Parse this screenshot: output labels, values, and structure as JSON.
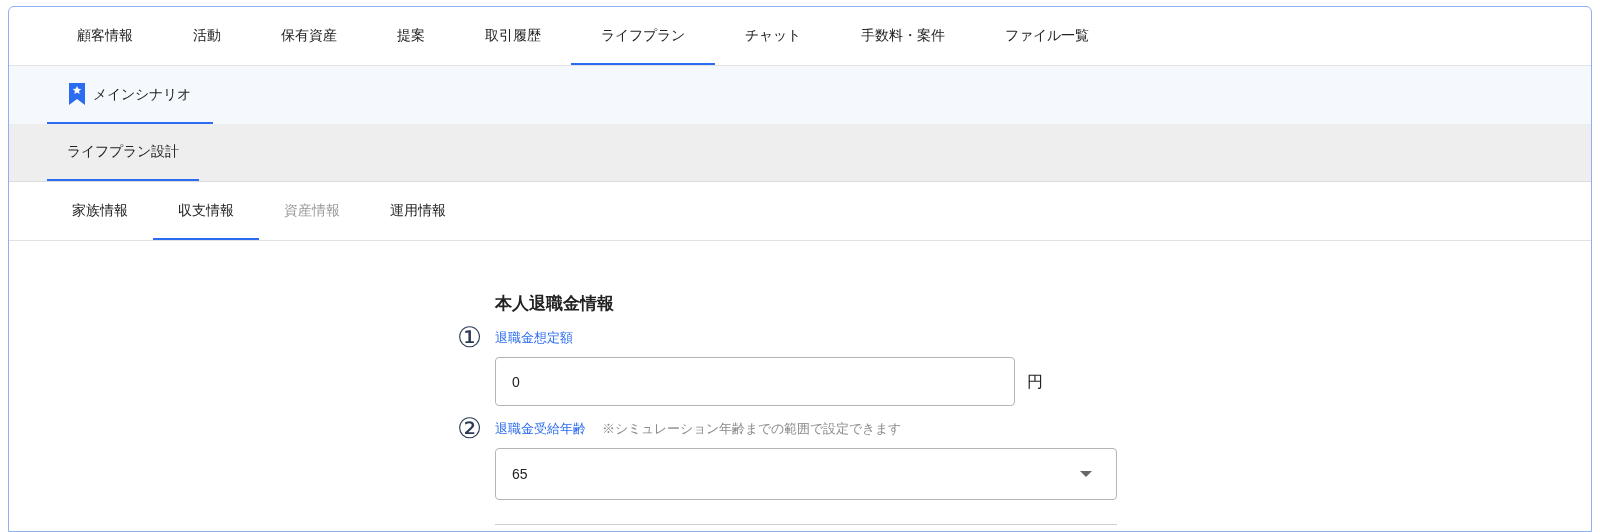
{
  "main_tabs": [
    {
      "label": "顧客情報",
      "selected": false
    },
    {
      "label": "活動",
      "selected": false
    },
    {
      "label": "保有資産",
      "selected": false
    },
    {
      "label": "提案",
      "selected": false
    },
    {
      "label": "取引履歴",
      "selected": false
    },
    {
      "label": "ライフプラン",
      "selected": true
    },
    {
      "label": "チャット",
      "selected": false
    },
    {
      "label": "手数料・案件",
      "selected": false
    },
    {
      "label": "ファイル一覧",
      "selected": false
    }
  ],
  "scenario_tab": {
    "label": "メインシナリオ",
    "selected": true
  },
  "design_tab": {
    "label": "ライフプラン設計",
    "selected": true
  },
  "sub_tabs": [
    {
      "label": "家族情報",
      "selected": false,
      "disabled": false
    },
    {
      "label": "収支情報",
      "selected": true,
      "disabled": false
    },
    {
      "label": "資産情報",
      "selected": false,
      "disabled": true
    },
    {
      "label": "運用情報",
      "selected": false,
      "disabled": false
    }
  ],
  "section_title": "本人退職金情報",
  "fields": [
    {
      "kind": "text",
      "marker": "①",
      "label": "退職金想定額",
      "value": "0",
      "unit": "円"
    },
    {
      "kind": "select",
      "marker": "②",
      "label": "退職金受給年齢",
      "hint": "※シミュレーション年齢までの範囲で設定できます",
      "value": "65"
    }
  ]
}
